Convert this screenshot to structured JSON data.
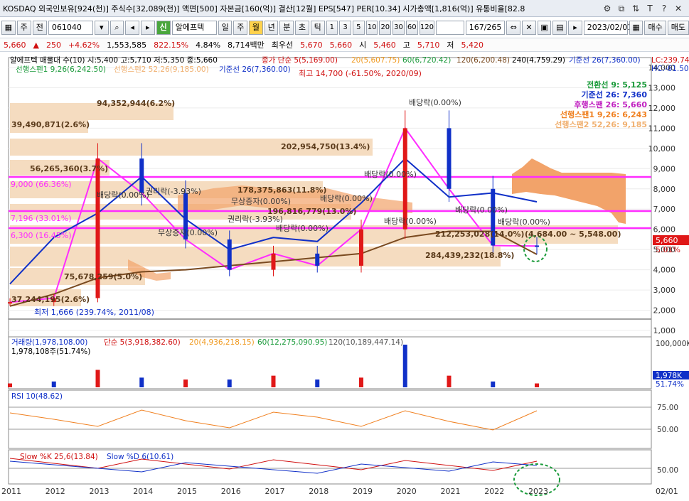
{
  "titlebar": {
    "text": "KOSDAQ 외국인보유[924(천)] 주식수[32,089(천)] 액면[500] 자본금[160(억)] 결산[12월] EPS[547] PER[10.34] 시가총액[1,816(억)] 유통비율[82.8",
    "icons": [
      "settings-icon",
      "copy-icon",
      "sort-icon",
      "text-icon",
      "help-icon",
      "close-icon"
    ],
    "icon_glyphs": [
      "⚙",
      "⧉",
      "⇅",
      "T",
      "?",
      "✕"
    ]
  },
  "toolbar": {
    "market": "주",
    "period": "전",
    "code": "061040",
    "badge": "신",
    "name": "알에프텍",
    "tabs": [
      "일",
      "주",
      "월",
      "년"
    ],
    "selected_tab": "월",
    "interval_tabs": [
      "분",
      "초",
      "틱"
    ],
    "intervals": [
      "1",
      "3",
      "5",
      "10",
      "20",
      "30",
      "60",
      "120"
    ],
    "count": "167/265",
    "date": "2023/02/01",
    "buy_label": "매수",
    "sell_label": "매도"
  },
  "quote": {
    "price": "5,660",
    "change": "250",
    "rate": "+4.62%",
    "volume": "1,553,585",
    "vol_ratio": "822.15%",
    "turnover": "4.84%",
    "amount": "8,714백만",
    "label_best": "최우선",
    "best": "5,670",
    "best2": "5,660",
    "open_label": "시",
    "open": "5,460",
    "high_label": "고",
    "high": "5,710",
    "low_label": "저",
    "low": "5,420"
  },
  "legend": {
    "main": "알에프텍 매물대 수(10)  시:5,400 고:5,710 저:5,350 종:5,660",
    "ma_label": "종가 단순 5(5,169.00)",
    "ma20": "20(5,607.75)",
    "ma60": "60(6,720.42)",
    "ma120": "120(6,200.48)",
    "ma240": "240(4,759.29)",
    "base": "기준선 26(7,360.00)",
    "lead1": "선행스펜1 9,26(6,242.50)",
    "lead2": "선행스펜2 52,26(9,185.00)",
    "base2": "기준선 26(7,360.00)",
    "lc": "LC:239.74",
    "hc": "HC:-61.50"
  },
  "ichimoku_box": {
    "conv": "전환선 9: 5,125",
    "base": "기준선 26: 7,360",
    "lag": "후행스팬 26: 5,660",
    "lead1": "선행스팬1 9,26: 6,243",
    "lead2": "선행스팬2 52,26: 9,185"
  },
  "annotations": {
    "high": "최고 14,700 (-61.50%, 2020/09)",
    "low": "최저 1,666 (239.74%, 2011/08)",
    "vp1": "94,352,944(6.2%)",
    "vp2": "39,490,871(2.6%)",
    "vp3": "202,954,750(13.4%)",
    "vp4": "56,265,360(3.7%)",
    "vp5": "178,375,863(11.8%)",
    "vp6": "196,816,779(13.0%)",
    "vp7": "212,253,028(14.0%)",
    "vp8": "284,439,232(18.8%)",
    "vp9": "75,678,259(5.0%)",
    "vp10": "37,244,195(2.6%)",
    "range": "(4,684.00 ~ 5,548.00)",
    "l9000": "9,000 (66.36%)",
    "l7196": "7,196 (33.01%)",
    "l6300": "6,300 (16.45%)",
    "div1": "배당락(0.00%)",
    "div2": "배당락(0.00%)",
    "div3": "배당락(0.00%)",
    "div4": "배당락(0.00%)",
    "div5": "배당락(0.00%)",
    "div6": "배당락(0.00%)",
    "div7": "배당락(0.00%)",
    "div8": "배당락(0.00%)",
    "rights1": "권리락(-3.93%)",
    "rights2": "권리락(-3.93%)",
    "bonus1": "무상증자(0.00%)",
    "bonus2": "무상증자(0.00%)",
    "price_tag": "5,660",
    "pct_tag": "5.01%"
  },
  "price_axis": [
    "14,000",
    "13,000",
    "12,000",
    "11,000",
    "10,000",
    "9,000",
    "8,000",
    "7,000",
    "6,000",
    "5,000",
    "4,000",
    "3,000",
    "2,000",
    "1,000"
  ],
  "volume_panel": {
    "legend": "거래량(1,978,108.00)",
    "ma5": "단순 5(3,918,382.60)",
    "ma20": "20(4,936,218.15)",
    "ma60": "60(12,275,090.95)",
    "ma120": "120(10,189,447.14)",
    "current": "1,978,108주(51.74%)",
    "axis_top": "100,000K",
    "tag": "1,978K",
    "tag_pct": "51.74%"
  },
  "rsi_panel": {
    "legend": "RSI 10(48.62)",
    "axis": [
      "75.00",
      "50.00"
    ]
  },
  "stoch_panel": {
    "legend_k": "Slow %K 25,6(13.84)",
    "legend_d": "Slow %D 6(10.61)",
    "axis": [
      "50.00"
    ]
  },
  "x_axis": [
    "2011",
    "2012",
    "2013",
    "2014",
    "2015",
    "2016",
    "2017",
    "2018",
    "2019",
    "2020",
    "2021",
    "2022",
    "2023"
  ],
  "x_axis_right": "02/01",
  "chart_data": {
    "type": "line",
    "title": "알에프텍",
    "x": [
      "2011",
      "2012",
      "2013",
      "2014",
      "2015",
      "2016",
      "2017",
      "2018",
      "2019",
      "2020",
      "2021",
      "2022",
      "2023"
    ],
    "ylim": [
      1000,
      14000
    ],
    "series": [
      {
        "name": "종가 단순 5",
        "values": [
          2400,
          2600,
          9500,
          7800,
          5500,
          4000,
          4800,
          4200,
          6000,
          11000,
          8000,
          5200,
          5169
        ]
      },
      {
        "name": "기준선 26",
        "values": [
          3300,
          5600,
          6800,
          8600,
          6500,
          5000,
          5600,
          5400,
          7300,
          9500,
          7600,
          7800,
          7360
        ]
      },
      {
        "name": "240",
        "values": [
          2200,
          2800,
          3600,
          3900,
          4000,
          4200,
          4400,
          4600,
          4800,
          5600,
          5900,
          5900,
          4759
        ]
      }
    ],
    "volume": [
      2,
      3,
      9,
      5,
      4,
      4,
      6,
      4,
      5,
      22,
      6,
      3,
      2
    ]
  }
}
